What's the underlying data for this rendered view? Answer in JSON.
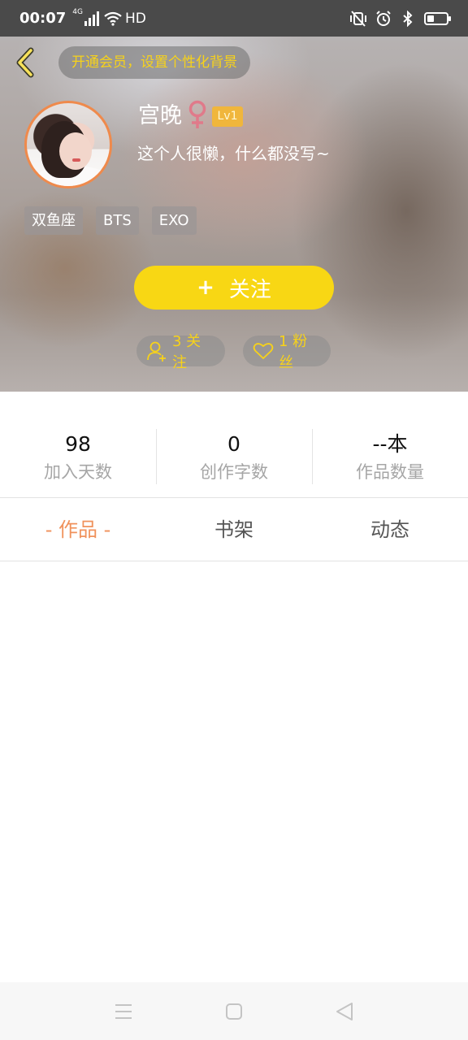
{
  "status_bar": {
    "time": "00:07",
    "network": "4G",
    "hd": "HD",
    "icons": [
      "signal-icon",
      "wifi-icon",
      "mute-vibrate-icon",
      "alarm-icon",
      "bluetooth-icon",
      "battery-icon"
    ],
    "battery_level": 0.25
  },
  "header": {
    "back_icon": "chevron-left-icon",
    "vip_prompt": "开通会员，设置个性化背景"
  },
  "profile": {
    "username": "宫晚",
    "gender_icon": "female-icon",
    "level": "Lv1",
    "bio": "这个人很懒，什么都没写~",
    "tags": [
      "双鱼座",
      "BTS",
      "EXO"
    ],
    "follow_button": {
      "plus": "+",
      "label": "关注"
    },
    "following": "3 关注",
    "fans": "1 粉丝"
  },
  "stats": [
    {
      "value": "98",
      "label": "加入天数"
    },
    {
      "value": "0",
      "label": "创作字数"
    },
    {
      "value": "--本",
      "label": "作品数量"
    }
  ],
  "tabs": [
    {
      "label": "- 作品 -",
      "active": true
    },
    {
      "label": "书架",
      "active": false
    },
    {
      "label": "动态",
      "active": false
    }
  ],
  "nav_bar": {
    "items": [
      "menu-icon",
      "home-icon",
      "back-icon"
    ]
  },
  "colors": {
    "accent_yellow": "#f8d714",
    "tab_active": "#f0925c",
    "avatar_ring": "#ef8a4c",
    "level_badge": "#f0b63c",
    "female_icon": "#e07a8a"
  }
}
